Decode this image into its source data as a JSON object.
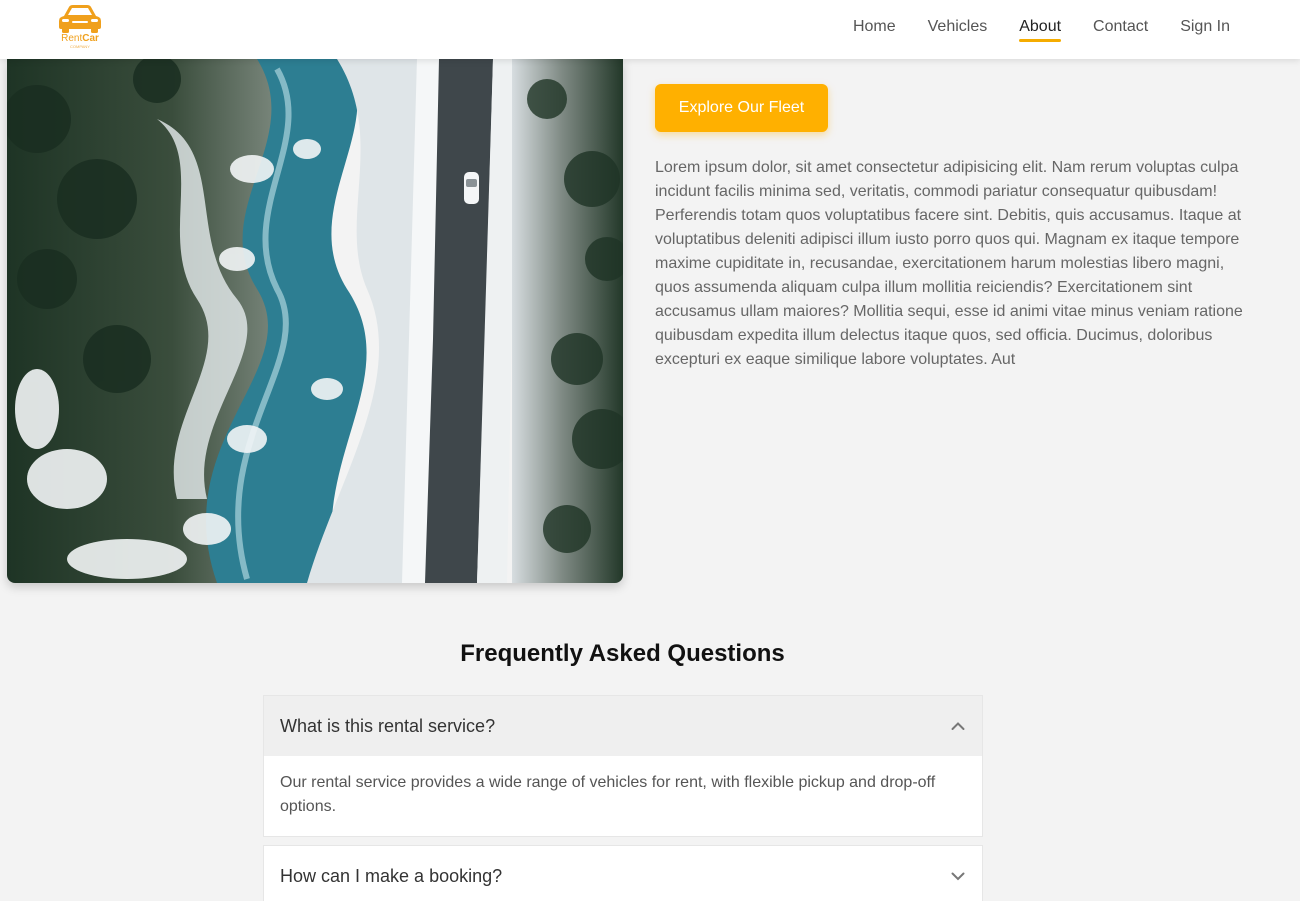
{
  "brand": {
    "name_part1": "Rent",
    "name_part2": "Car",
    "tagline": "COMPANY",
    "color": "#f0a01c"
  },
  "nav": {
    "items": [
      {
        "label": "Home",
        "active": false
      },
      {
        "label": "Vehicles",
        "active": false
      },
      {
        "label": "About",
        "active": true
      },
      {
        "label": "Contact",
        "active": false
      },
      {
        "label": "Sign In",
        "active": false
      }
    ]
  },
  "hero": {
    "image_icon": "aerial-snowy-road-photo",
    "cta_label": "Explore Our Fleet",
    "body": "Lorem ipsum dolor, sit amet consectetur adipisicing elit. Nam rerum voluptas culpa incidunt facilis minima sed, veritatis, commodi pariatur consequatur quibusdam! Perferendis totam quos voluptatibus facere sint. Debitis, quis accusamus. Itaque at voluptatibus deleniti adipisci illum iusto porro quos qui. Magnam ex itaque tempore maxime cupiditate in, recusandae, exercitationem harum molestias libero magni, quos assumenda aliquam culpa illum mollitia reiciendis? Exercitationem sint accusamus ullam maiores? Mollitia sequi, esse id animi vitae minus veniam ratione quibusdam expedita illum delectus itaque quos, sed officia. Ducimus, doloribus excepturi ex eaque similique labore voluptates. Aut"
  },
  "faq": {
    "title": "Frequently Asked Questions",
    "items": [
      {
        "question": "What is this rental service?",
        "answer": "Our rental service provides a wide range of vehicles for rent, with flexible pickup and drop-off options.",
        "open": true
      },
      {
        "question": "How can I make a booking?",
        "open": false
      }
    ]
  },
  "colors": {
    "accent": "#ffb000",
    "background": "#f3f3f3"
  }
}
